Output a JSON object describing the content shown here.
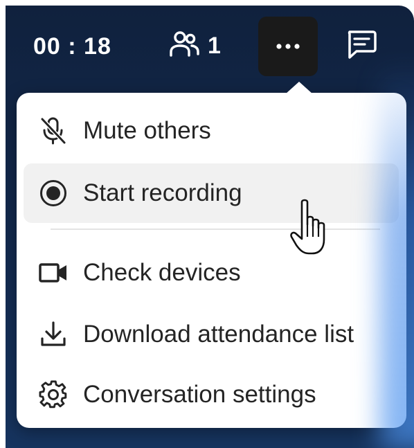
{
  "topbar": {
    "timer": "00 : 18",
    "participants_count": "1",
    "icons": {
      "participants": "people-icon",
      "more": "more-horizontal-icon",
      "chat": "chat-icon"
    }
  },
  "menu": {
    "items": [
      {
        "label": "Mute others",
        "icon": "mic-off-icon"
      },
      {
        "label": "Start recording",
        "icon": "record-icon",
        "hovered": true
      },
      {
        "label": "Check devices",
        "icon": "video-camera-icon"
      },
      {
        "label": "Download attendance list",
        "icon": "download-icon"
      },
      {
        "label": "Conversation settings",
        "icon": "gear-icon"
      }
    ]
  },
  "colors": {
    "background_top": "#10213d",
    "background_bottom": "#16345f",
    "menu_bg": "#ffffff",
    "hover_bg": "#f1f1f1",
    "text": "#242424",
    "more_button_bg": "#1a1a1a"
  }
}
